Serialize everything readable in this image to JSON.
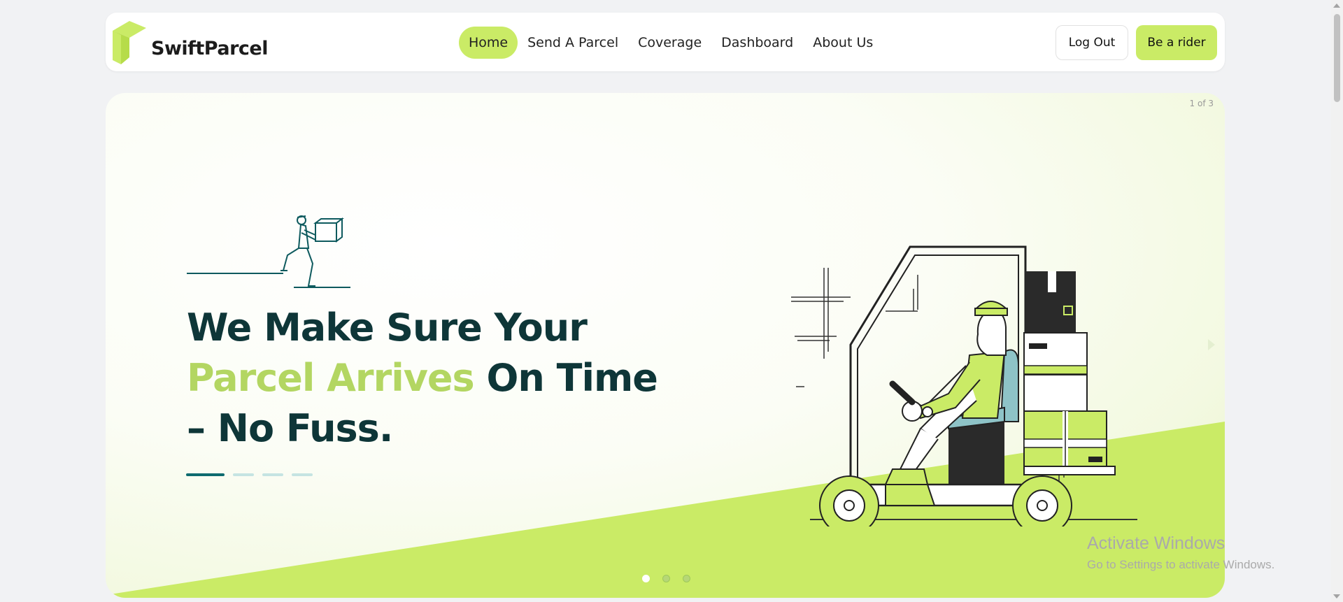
{
  "brand": {
    "name": "SwiftParcel",
    "logo_icon": "cube-logo-icon",
    "color_accent": "#caeb66",
    "color_dark": "#0e3638"
  },
  "nav": {
    "links": [
      {
        "label": "Home",
        "active": true
      },
      {
        "label": "Send A Parcel",
        "active": false
      },
      {
        "label": "Coverage",
        "active": false
      },
      {
        "label": "Dashboard",
        "active": false
      },
      {
        "label": "About Us",
        "active": false
      }
    ],
    "logout_label": "Log Out",
    "rider_label": "Be a rider"
  },
  "hero": {
    "slide_counter": "1 of 3",
    "headline_line1": "We Make Sure Your",
    "headline_accent": "Parcel Arrives",
    "headline_rest": " On Time",
    "headline_line3": "– No Fuss.",
    "active_slide": 1,
    "slide_count": 3
  },
  "os_watermark": {
    "title": "Activate Windows",
    "subtitle": "Go to Settings to activate Windows."
  }
}
